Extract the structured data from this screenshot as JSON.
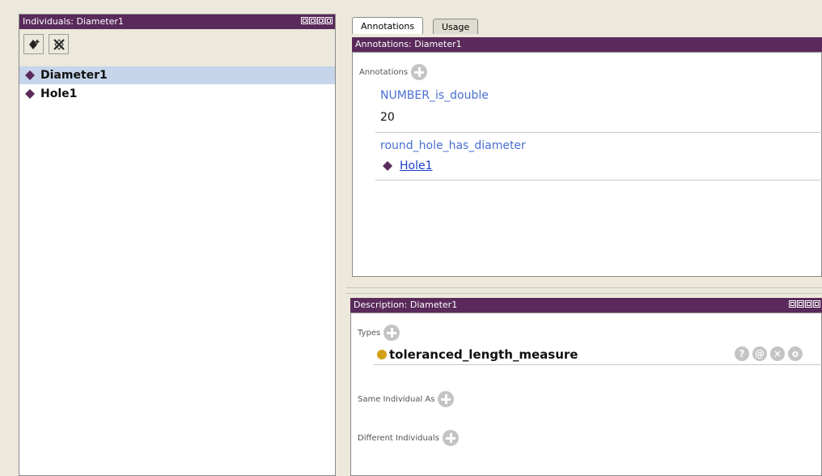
{
  "left_panel": {
    "title": "Individuals: Diameter1",
    "toolbar": {
      "add_icon": "add-individual-icon",
      "delete_icon": "delete-individual-icon"
    },
    "items": [
      {
        "label": "Diameter1",
        "selected": true
      },
      {
        "label": "Hole1",
        "selected": false
      }
    ]
  },
  "tabs": [
    {
      "label": "Annotations",
      "active": true
    },
    {
      "label": "Usage",
      "active": false
    }
  ],
  "annotations_panel": {
    "title": "Annotations: Diameter1",
    "section_label": "Annotations",
    "entries": [
      {
        "property": "NUMBER_is_double",
        "value": "20"
      },
      {
        "property": "round_hole_has_diameter",
        "value": "Hole1",
        "is_link": true
      }
    ]
  },
  "description_panel": {
    "title": "Description: Diameter1",
    "types_label": "Types",
    "type_value": "toleranced_length_measure",
    "type_controls": [
      "?",
      "@",
      "×",
      "o"
    ],
    "same_individual_label": "Same Individual As",
    "different_individuals_label": "Different Individuals"
  },
  "colors": {
    "header_purple": "#5a2a5a",
    "selection_blue": "#c6d5e9",
    "property_blue": "#4a6fd1",
    "individual_diamond": "#5a2a5a",
    "class_dot": "#d4a017"
  }
}
